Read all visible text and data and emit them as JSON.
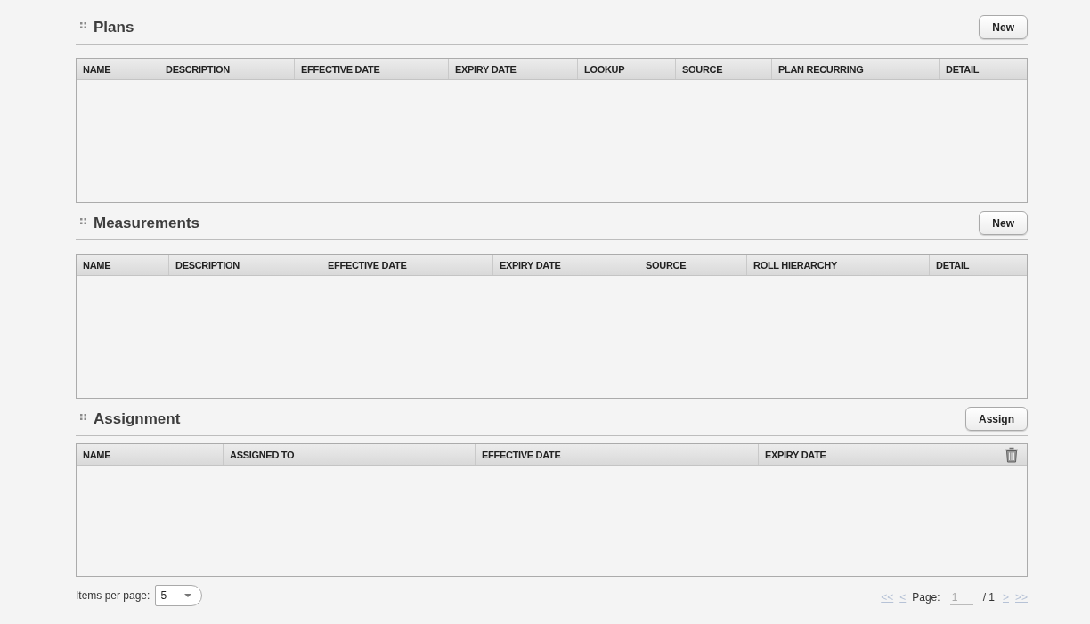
{
  "sections": [
    {
      "title": "Plans",
      "button": "New",
      "columns": [
        "NAME",
        "DESCRIPTION",
        "EFFECTIVE DATE",
        "EXPIRY DATE",
        "LOOKUP",
        "SOURCE",
        "PLAN RECURRING",
        "DETAIL"
      ],
      "delete_column": false
    },
    {
      "title": "Measurements",
      "button": "New",
      "columns": [
        "NAME",
        "DESCRIPTION",
        "EFFECTIVE DATE",
        "EXPIRY DATE",
        "SOURCE",
        "ROLL HIERARCHY",
        "DETAIL"
      ],
      "delete_column": false
    },
    {
      "title": "Assignment",
      "button": "Assign",
      "columns": [
        "NAME",
        "ASSIGNED TO",
        "EFFECTIVE DATE",
        "EXPIRY DATE"
      ],
      "delete_column": true
    }
  ],
  "footer": {
    "items_per_page": {
      "label": "Items per page:",
      "value": "5"
    },
    "pager": {
      "first": {
        "label": "<<",
        "disabled": true
      },
      "previous": {
        "label": "<",
        "disabled": true
      },
      "page_label": "Page:",
      "page_field": {
        "value": "1",
        "disabled": true
      },
      "total": "/ 1",
      "next": {
        "label": ">",
        "disabled": true
      },
      "last": {
        "label": ">>",
        "disabled": true
      }
    }
  }
}
